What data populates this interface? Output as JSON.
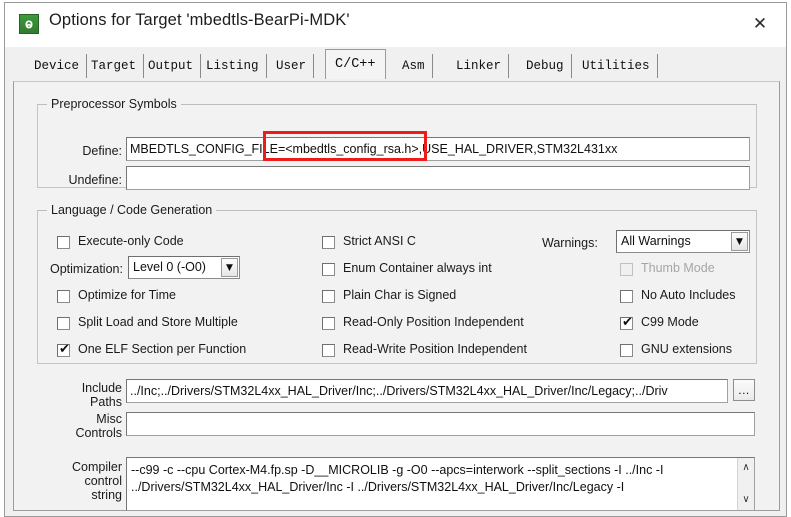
{
  "window": {
    "title": "Options for Target 'mbedtls-BearPi-MDK'",
    "icon": "keil-uvision-icon",
    "icon_glyph": "ⱺ",
    "close_label": "✕"
  },
  "tabs": [
    {
      "label": "Device",
      "active": false
    },
    {
      "label": "Target",
      "active": false
    },
    {
      "label": "Output",
      "active": false
    },
    {
      "label": "Listing",
      "active": false
    },
    {
      "label": "User",
      "active": false
    },
    {
      "label": "C/C++",
      "active": true
    },
    {
      "label": "Asm",
      "active": false
    },
    {
      "label": "Linker",
      "active": false
    },
    {
      "label": "Debug",
      "active": false
    },
    {
      "label": "Utilities",
      "active": false
    }
  ],
  "preprocessor": {
    "group_title": "Preprocessor Symbols",
    "define_label": "Define:",
    "define_value": "MBEDTLS_CONFIG_FILE=<mbedtls_config_rsa.h>,USE_HAL_DRIVER,STM32L431xx",
    "undefine_label": "Undefine:",
    "undefine_value": ""
  },
  "language": {
    "group_title": "Language / Code Generation",
    "left_column": [
      {
        "label": "Execute-only Code",
        "checked": false,
        "enabled": true
      },
      {
        "label": "Optimize for Time",
        "checked": false,
        "enabled": true
      },
      {
        "label": "Split Load and Store Multiple",
        "checked": false,
        "enabled": true
      },
      {
        "label": "One ELF Section per Function",
        "checked": true,
        "enabled": true
      }
    ],
    "optimization_label": "Optimization:",
    "optimization_value": "Level 0 (-O0)",
    "middle_column": [
      {
        "label": "Strict ANSI C",
        "checked": false,
        "enabled": true
      },
      {
        "label": "Enum Container always int",
        "checked": false,
        "enabled": true
      },
      {
        "label": "Plain Char is Signed",
        "checked": false,
        "enabled": true
      },
      {
        "label": "Read-Only Position Independent",
        "checked": false,
        "enabled": true
      },
      {
        "label": "Read-Write Position Independent",
        "checked": false,
        "enabled": true
      }
    ],
    "warnings_label": "Warnings:",
    "warnings_value": "All Warnings",
    "right_column": [
      {
        "label": "Thumb Mode",
        "checked": false,
        "enabled": false
      },
      {
        "label": "No Auto Includes",
        "checked": false,
        "enabled": true
      },
      {
        "label": "C99 Mode",
        "checked": true,
        "enabled": true
      },
      {
        "label": "GNU extensions",
        "checked": false,
        "enabled": true
      }
    ]
  },
  "paths": {
    "include_label_line1": "Include",
    "include_label_line2": "Paths",
    "include_value": "../Inc;../Drivers/STM32L4xx_HAL_Driver/Inc;../Drivers/STM32L4xx_HAL_Driver/Inc/Legacy;../Driv",
    "browse_label": "...",
    "misc_label_line1": "Misc",
    "misc_label_line2": "Controls",
    "misc_value": "",
    "compiler_label_line1": "Compiler",
    "compiler_label_line2": "control",
    "compiler_label_line3": "string",
    "compiler_line1": "--c99 -c --cpu Cortex-M4.fp.sp -D__MICROLIB -g -O0 --apcs=interwork --split_sections -I ../Inc -I",
    "compiler_line2": "../Drivers/STM32L4xx_HAL_Driver/Inc -I ../Drivers/STM32L4xx_HAL_Driver/Inc/Legacy -I",
    "scroll_up": "∧",
    "scroll_down": "∨"
  },
  "annotation": {
    "color": "#ee1c18",
    "target": "define-value-highlight"
  },
  "glyphs": {
    "check": "✔",
    "combo_arrow": "▼"
  }
}
